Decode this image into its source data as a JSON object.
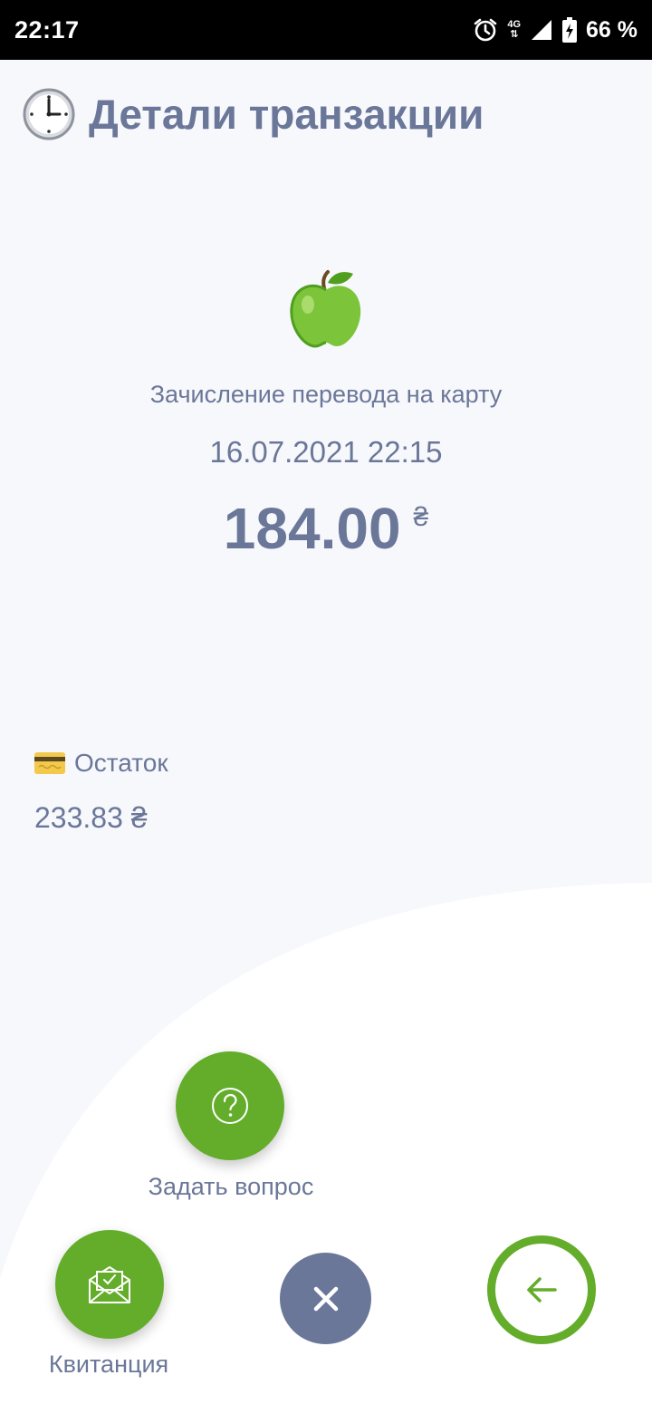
{
  "status_bar": {
    "time": "22:17",
    "network": "4G",
    "battery": "66 %",
    "icons": [
      "alarm-icon",
      "network-4g-icon",
      "signal-icon",
      "battery-charging-icon"
    ]
  },
  "header": {
    "icon": "clock-icon",
    "title": "Детали транзакции"
  },
  "transaction": {
    "icon": "green-apple-icon",
    "description": "Зачисление перевода на карту",
    "datetime": "16.07.2021 22:15",
    "amount": "184.00",
    "currency": "₴"
  },
  "balance": {
    "icon": "credit-card-icon",
    "label": "Остаток",
    "value": "233.83 ₴"
  },
  "actions": {
    "ask_question": {
      "label": "Задать вопрос",
      "icon": "question-icon"
    },
    "receipt": {
      "label": "Квитанция",
      "icon": "envelope-check-icon"
    },
    "close": {
      "icon": "close-icon"
    },
    "back": {
      "icon": "arrow-left-icon"
    }
  },
  "colors": {
    "accent_green": "#63ad2b",
    "text_slate": "#6b7799",
    "background": "#f7f8fc"
  }
}
